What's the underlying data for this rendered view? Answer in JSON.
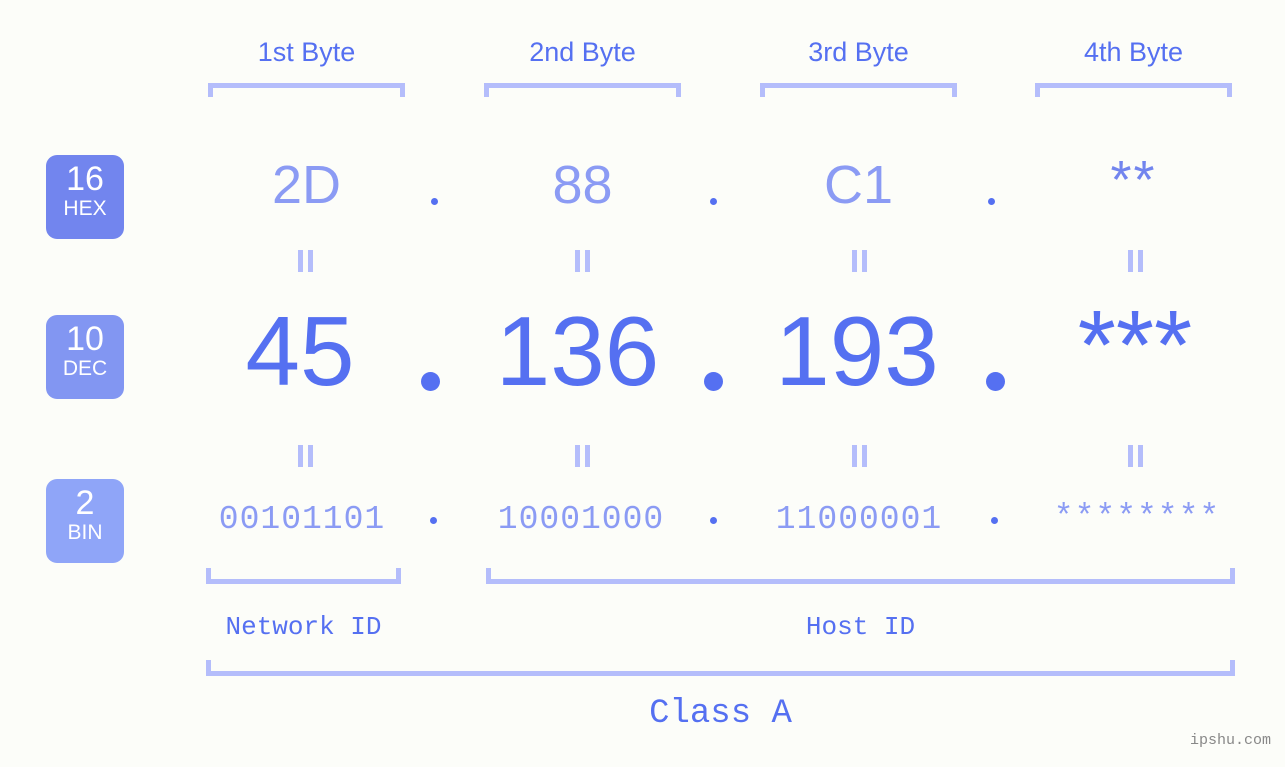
{
  "page": {
    "background_color": "#fcfdf9",
    "accent_color": "#5570f1",
    "accent_light_color": "#b4bdfb",
    "accent_mid_color": "#8b9bf4",
    "watermark": "ipshu.com"
  },
  "byte_headers": [
    {
      "label": "1st Byte"
    },
    {
      "label": "2nd Byte"
    },
    {
      "label": "3rd Byte"
    },
    {
      "label": "4th Byte"
    }
  ],
  "bases": [
    {
      "number": "16",
      "name": "HEX",
      "color": "#7285ee"
    },
    {
      "number": "10",
      "name": "DEC",
      "color": "#8296f2"
    },
    {
      "number": "2",
      "name": "BIN",
      "color": "#8fa5f8"
    }
  ],
  "rows": {
    "hex": {
      "base": "16",
      "label": "HEX",
      "values": [
        "2D",
        "88",
        "C1",
        "**"
      ],
      "separator": "."
    },
    "dec": {
      "base": "10",
      "label": "DEC",
      "values": [
        "45",
        "136",
        "193",
        "***"
      ],
      "separator": "."
    },
    "bin": {
      "base": "2",
      "label": "BIN",
      "values": [
        "00101101",
        "10001000",
        "11000001",
        "********"
      ],
      "separator": "."
    }
  },
  "equals_marks": {
    "glyph": "||",
    "count_per_row": 4
  },
  "footer": {
    "network_id_label": "Network ID",
    "host_id_label": "Host ID",
    "class_label": "Class A"
  }
}
